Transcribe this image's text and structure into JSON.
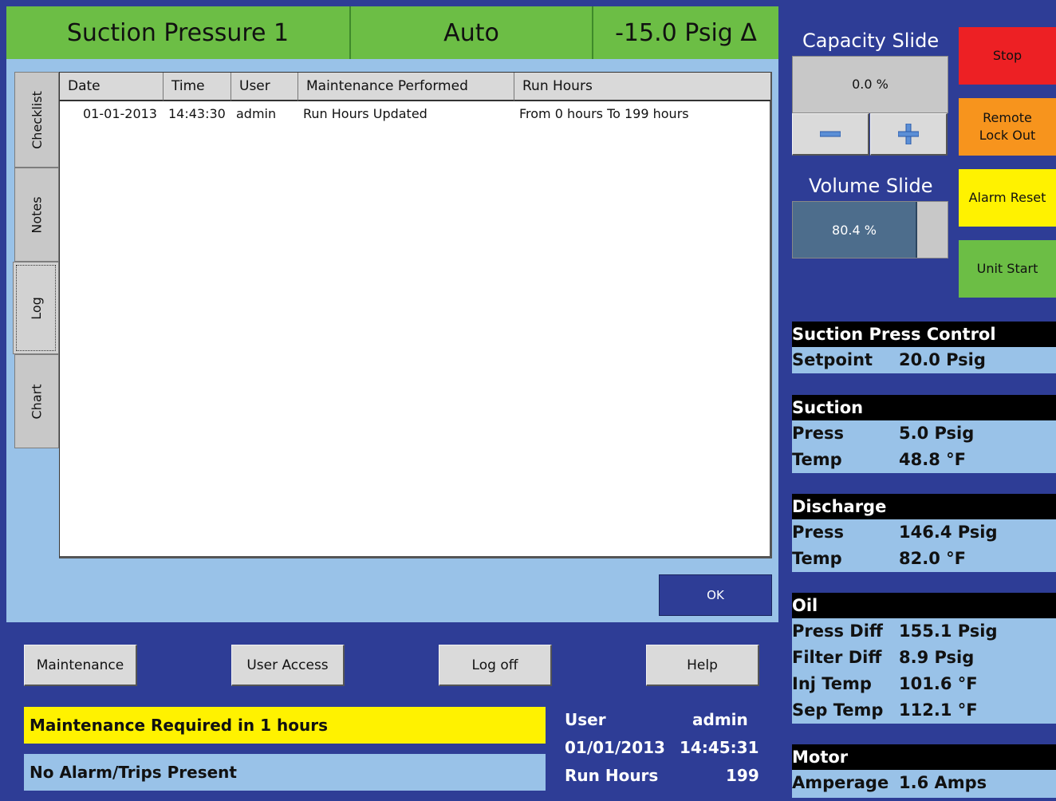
{
  "header": {
    "title": "Suction Pressure 1",
    "mode": "Auto",
    "reading": "-15.0 Psig Δ"
  },
  "tabs": [
    {
      "label": "Checklist"
    },
    {
      "label": "Notes"
    },
    {
      "label": "Log"
    },
    {
      "label": "Chart"
    }
  ],
  "log": {
    "columns": [
      "Date",
      "Time",
      "User",
      "Maintenance Performed",
      "Run Hours"
    ],
    "rows": [
      [
        "01-01-2013",
        "14:43:30",
        "admin",
        "Run Hours Updated",
        "From 0 hours To 199 hours"
      ]
    ]
  },
  "ok_label": "OK",
  "bottom_buttons": {
    "maintenance": "Maintenance",
    "user_access": "User Access",
    "log_off": "Log off",
    "help": "Help"
  },
  "status": {
    "maintenance_msg": "Maintenance Required in 1 hours",
    "alarm_msg": "No Alarm/Trips Present"
  },
  "info": {
    "user_label": "User",
    "user_value": "admin",
    "date": "01/01/2013",
    "time": "14:45:31",
    "run_hours_label": "Run Hours",
    "run_hours_value": "199"
  },
  "capacity": {
    "title": "Capacity Slide",
    "value": "0.0 %",
    "level": 0.0
  },
  "volume": {
    "title": "Volume Slide",
    "value": "80.4 %",
    "level": 0.804
  },
  "actions": {
    "stop": "Stop",
    "remote_lockout": "Remote Lock Out",
    "alarm_reset": "Alarm Reset",
    "unit_start": "Unit Start"
  },
  "sections": {
    "control": {
      "title": "Suction Press Control",
      "rows": [
        {
          "label": "Setpoint",
          "value": "20.0 Psig"
        }
      ]
    },
    "suction": {
      "title": "Suction",
      "rows": [
        {
          "label": "Press",
          "value": "5.0 Psig"
        },
        {
          "label": "Temp",
          "value": "48.8 °F"
        }
      ]
    },
    "discharge": {
      "title": "Discharge",
      "rows": [
        {
          "label": "Press",
          "value": "146.4 Psig"
        },
        {
          "label": "Temp",
          "value": "82.0 °F"
        }
      ]
    },
    "oil": {
      "title": "Oil",
      "rows": [
        {
          "label": "Press Diff",
          "value": "155.1 Psig"
        },
        {
          "label": "Filter Diff",
          "value": "8.9 Psig"
        },
        {
          "label": "Inj Temp",
          "value": "101.6 °F"
        },
        {
          "label": "Sep Temp",
          "value": "112.1 °F"
        }
      ]
    },
    "motor": {
      "title": "Motor",
      "rows": [
        {
          "label": "Amperage",
          "value": "1.6 Amps"
        }
      ]
    }
  },
  "colors": {
    "header_green": "#6cbe45",
    "navy": "#2e3d96",
    "light_blue": "#99c2e8",
    "stop_red": "#ed2024",
    "lockout_orange": "#f7941d",
    "reset_yellow": "#fff200",
    "start_green": "#6cbe45",
    "volume_fill": "#4d6d8c"
  }
}
